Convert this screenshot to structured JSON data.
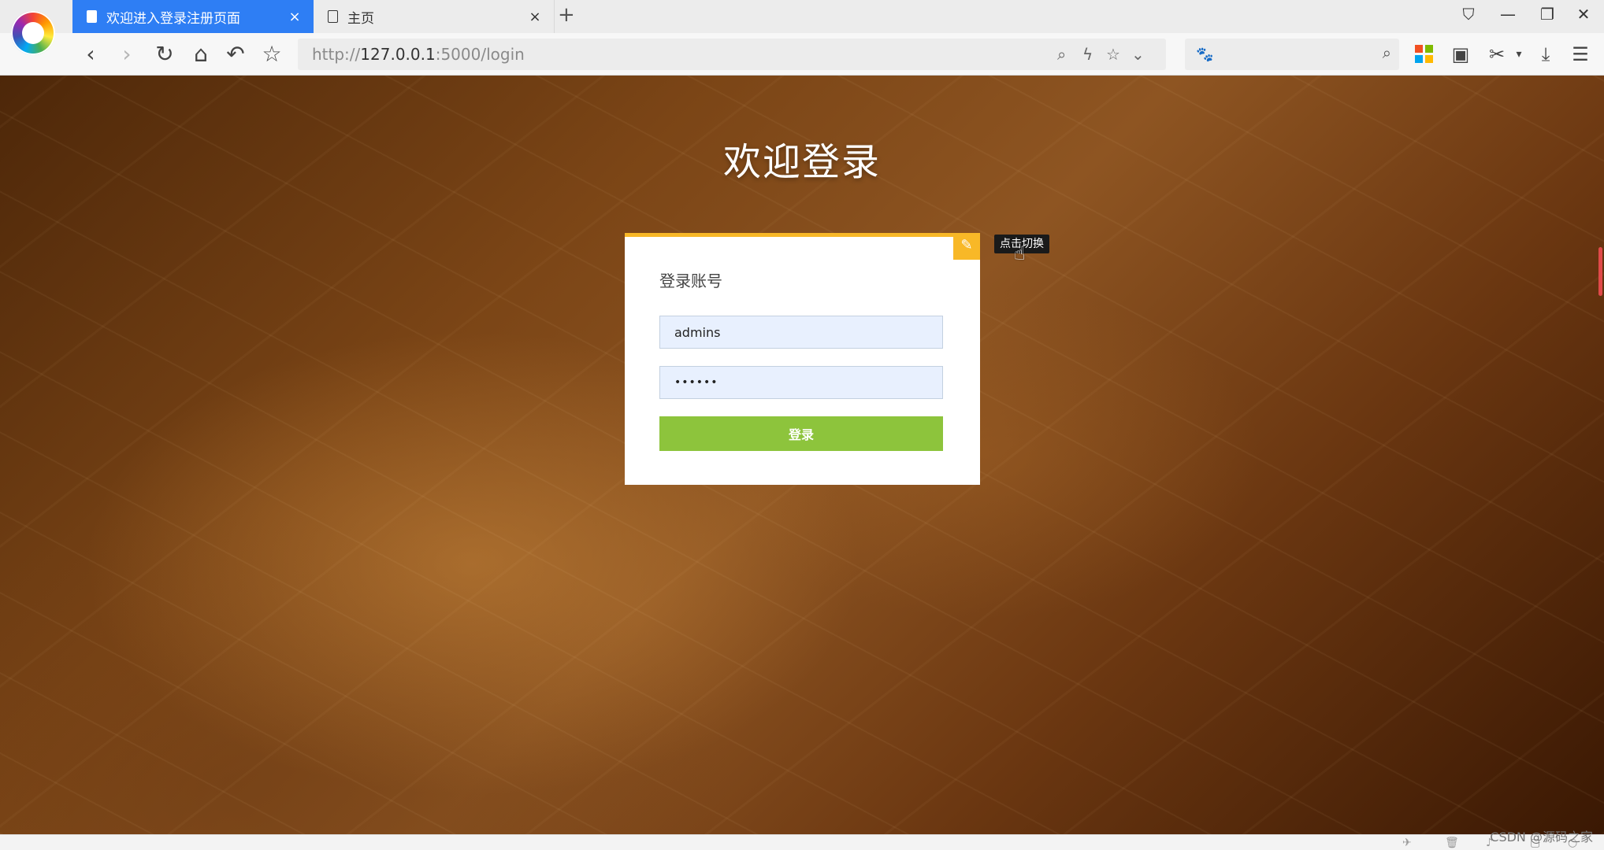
{
  "browser": {
    "tabs": [
      {
        "label": "欢迎进入登录注册页面",
        "close": "×"
      },
      {
        "label": "主页",
        "close": "×"
      }
    ],
    "new_tab": "+",
    "window_controls": {
      "pin": "⛉",
      "minimize": "—",
      "restore": "❐",
      "close": "✕"
    },
    "nav": {
      "back": "‹",
      "forward": "›",
      "reload": "↻",
      "home": "⌂",
      "undo": "↶",
      "bookmark": "☆"
    },
    "address": {
      "scheme": "http://",
      "host": "127.0.0.1",
      "rest": ":5000/login"
    },
    "url_tools": {
      "zoom": "⌕",
      "lightning": "ϟ",
      "star": "☆",
      "dropdown": "⌄"
    },
    "search": {
      "engine_icon": "🐾",
      "placeholder": "",
      "search_icon": "⌕"
    },
    "extensions": {
      "reader": "▣",
      "scissors": "✂",
      "scissors_dropdown": "▾",
      "download": "⤓",
      "menu": "☰"
    }
  },
  "page": {
    "title": "欢迎登录",
    "card": {
      "heading": "登录账号",
      "username_value": "admins",
      "password_value": "••••••",
      "submit_label": "登录",
      "edit_icon": "✎"
    },
    "tooltip": "点击切换",
    "cursor": "☝"
  },
  "watermark": "CSDN @源码之家",
  "colors": {
    "tab_active": "#2e7ef4",
    "card_accent": "#f8b827",
    "login_button": "#8dc43c",
    "input_bg": "#e8f0fe"
  }
}
